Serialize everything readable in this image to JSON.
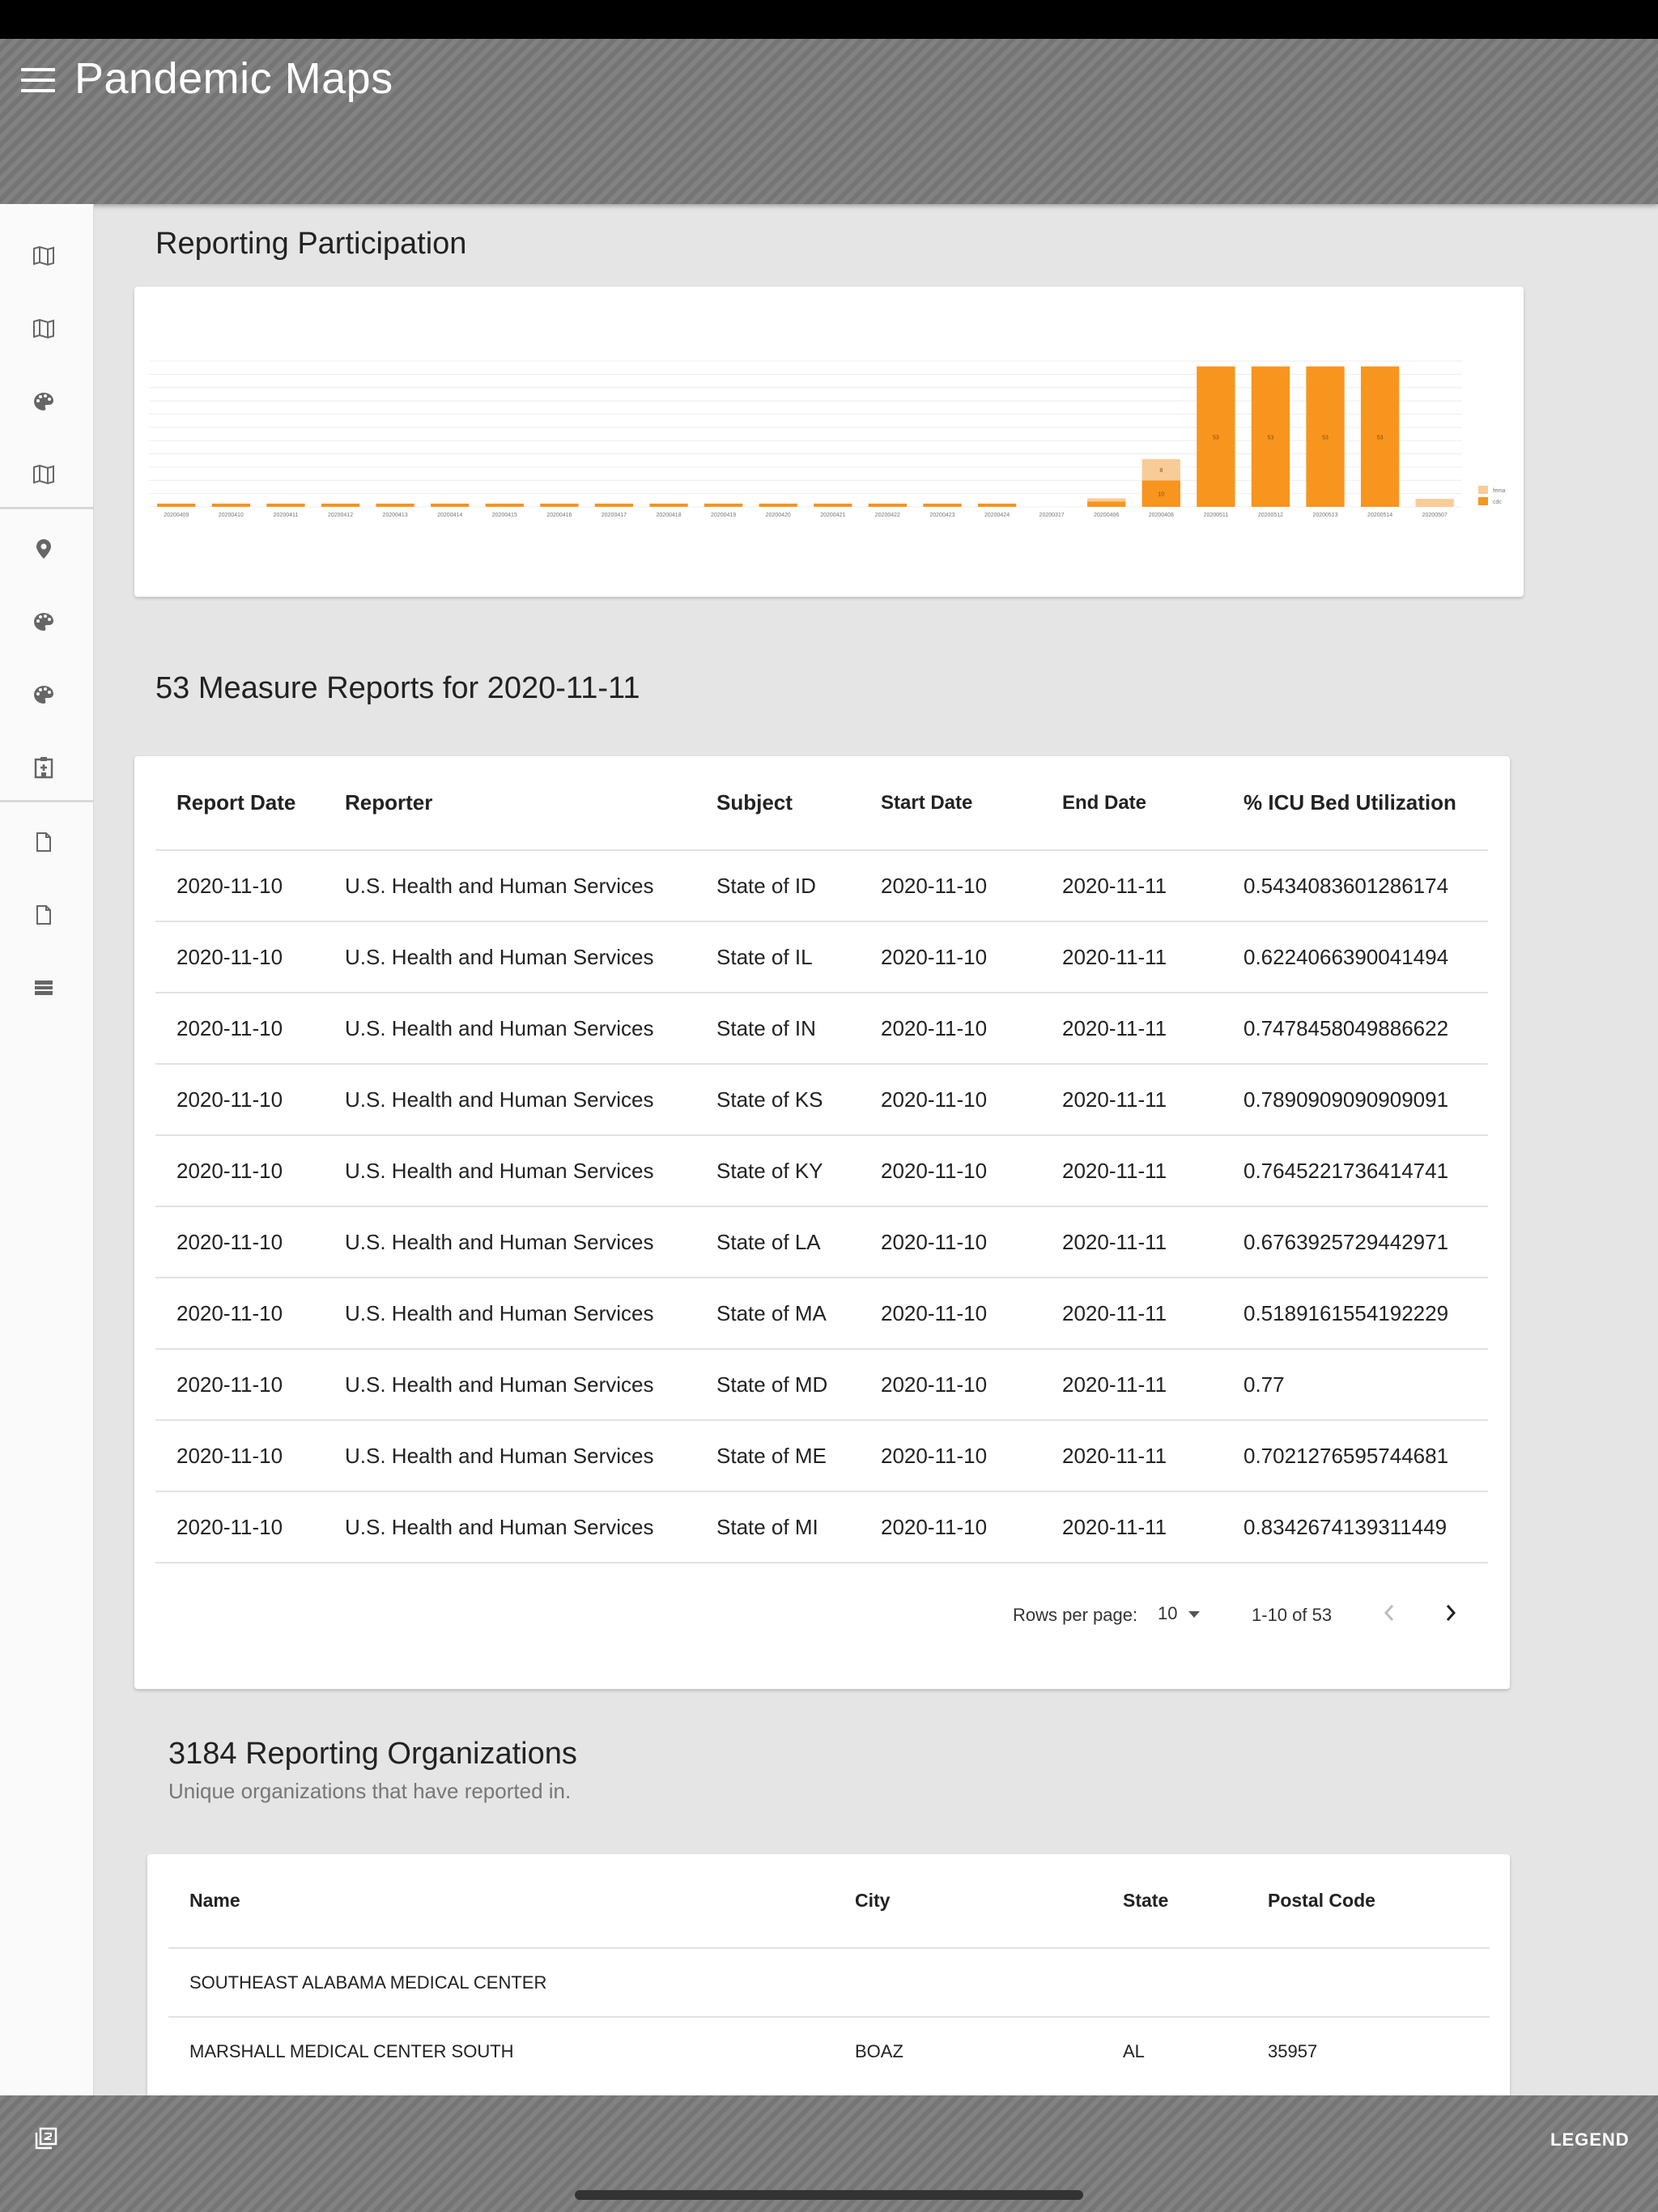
{
  "app": {
    "title": "Pandemic Maps"
  },
  "sidebar": {
    "items": [
      {
        "icon": "map-icon"
      },
      {
        "icon": "map-icon"
      },
      {
        "icon": "palette-icon"
      },
      {
        "icon": "map-icon"
      },
      {
        "icon": "map-pin-icon"
      },
      {
        "icon": "palette-icon"
      },
      {
        "icon": "palette-icon"
      },
      {
        "icon": "hospital-icon"
      },
      {
        "icon": "document-icon"
      },
      {
        "icon": "document-icon"
      },
      {
        "icon": "table-icon"
      }
    ]
  },
  "participation": {
    "title": "Reporting Participation",
    "chart_data": {
      "type": "bar",
      "stacked": true,
      "categories": [
        "20200409",
        "20200410",
        "20200411",
        "20200412",
        "20200413",
        "20200414",
        "20200415",
        "20200416",
        "20200417",
        "20200418",
        "20200419",
        "20200420",
        "20200421",
        "20200422",
        "20200423",
        "20200424",
        "20200317",
        "20200406",
        "20200408",
        "20200511",
        "20200512",
        "20200513",
        "20200514",
        "20200507"
      ],
      "series": [
        {
          "name": "cdc",
          "color": "#f7951e",
          "values": [
            1,
            1,
            1,
            1,
            1,
            1,
            1,
            1,
            1,
            1,
            1,
            1,
            1,
            1,
            1,
            1,
            0,
            2,
            10,
            53,
            53,
            53,
            53,
            0
          ]
        },
        {
          "name": "fema",
          "color": "#f9cb97",
          "values": [
            0,
            0,
            0,
            0,
            0,
            0,
            0,
            0,
            0,
            0,
            0,
            0,
            0,
            0,
            0,
            0,
            0,
            1,
            8,
            0,
            0,
            0,
            0,
            3
          ]
        }
      ],
      "bar_labels": [
        "",
        "",
        "",
        "",
        "",
        "",
        "",
        "",
        "",
        "",
        "",
        "",
        "",
        "",
        "",
        "",
        "",
        "",
        "10",
        "53",
        "53",
        "53",
        "53",
        ""
      ],
      "bar_labels_top": [
        "",
        "",
        "",
        "",
        "",
        "",
        "",
        "",
        "",
        "",
        "",
        "",
        "",
        "",
        "",
        "",
        "",
        "",
        "8",
        "",
        "",
        "",
        "",
        ""
      ],
      "ylim": [
        0,
        55
      ],
      "grid": true,
      "legend": "right"
    }
  },
  "measures": {
    "title": "53 Measure Reports for 2020-11-11",
    "columns": [
      "Report Date",
      "Reporter",
      "Subject",
      "Start Date",
      "End Date",
      "% ICU Bed Utilization"
    ],
    "rows": [
      [
        "2020-11-10",
        "U.S. Health and Human Services",
        "State of ID",
        "2020-11-10",
        "2020-11-11",
        "0.5434083601286174"
      ],
      [
        "2020-11-10",
        "U.S. Health and Human Services",
        "State of IL",
        "2020-11-10",
        "2020-11-11",
        "0.6224066390041494"
      ],
      [
        "2020-11-10",
        "U.S. Health and Human Services",
        "State of IN",
        "2020-11-10",
        "2020-11-11",
        "0.7478458049886622"
      ],
      [
        "2020-11-10",
        "U.S. Health and Human Services",
        "State of KS",
        "2020-11-10",
        "2020-11-11",
        "0.7890909090909091"
      ],
      [
        "2020-11-10",
        "U.S. Health and Human Services",
        "State of KY",
        "2020-11-10",
        "2020-11-11",
        "0.7645221736414741"
      ],
      [
        "2020-11-10",
        "U.S. Health and Human Services",
        "State of LA",
        "2020-11-10",
        "2020-11-11",
        "0.6763925729442971"
      ],
      [
        "2020-11-10",
        "U.S. Health and Human Services",
        "State of MA",
        "2020-11-10",
        "2020-11-11",
        "0.5189161554192229"
      ],
      [
        "2020-11-10",
        "U.S. Health and Human Services",
        "State of MD",
        "2020-11-10",
        "2020-11-11",
        "0.77"
      ],
      [
        "2020-11-10",
        "U.S. Health and Human Services",
        "State of ME",
        "2020-11-10",
        "2020-11-11",
        "0.7021276595744681"
      ],
      [
        "2020-11-10",
        "U.S. Health and Human Services",
        "State of MI",
        "2020-11-10",
        "2020-11-11",
        "0.8342674139311449"
      ]
    ],
    "pagination": {
      "rows_label": "Rows per page:",
      "rows_value": "10",
      "range": "1-10 of 53"
    }
  },
  "organizations": {
    "title": "3184 Reporting Organizations",
    "subtitle": "Unique organizations that have reported in.",
    "columns": [
      "Name",
      "City",
      "State",
      "Postal Code"
    ],
    "rows": [
      [
        "SOUTHEAST ALABAMA MEDICAL CENTER",
        "",
        "",
        ""
      ],
      [
        "MARSHALL MEDICAL CENTER SOUTH",
        "BOAZ",
        "AL",
        "35957"
      ]
    ]
  },
  "bottom": {
    "legend_label": "LEGEND",
    "icon": "layers-icon"
  }
}
